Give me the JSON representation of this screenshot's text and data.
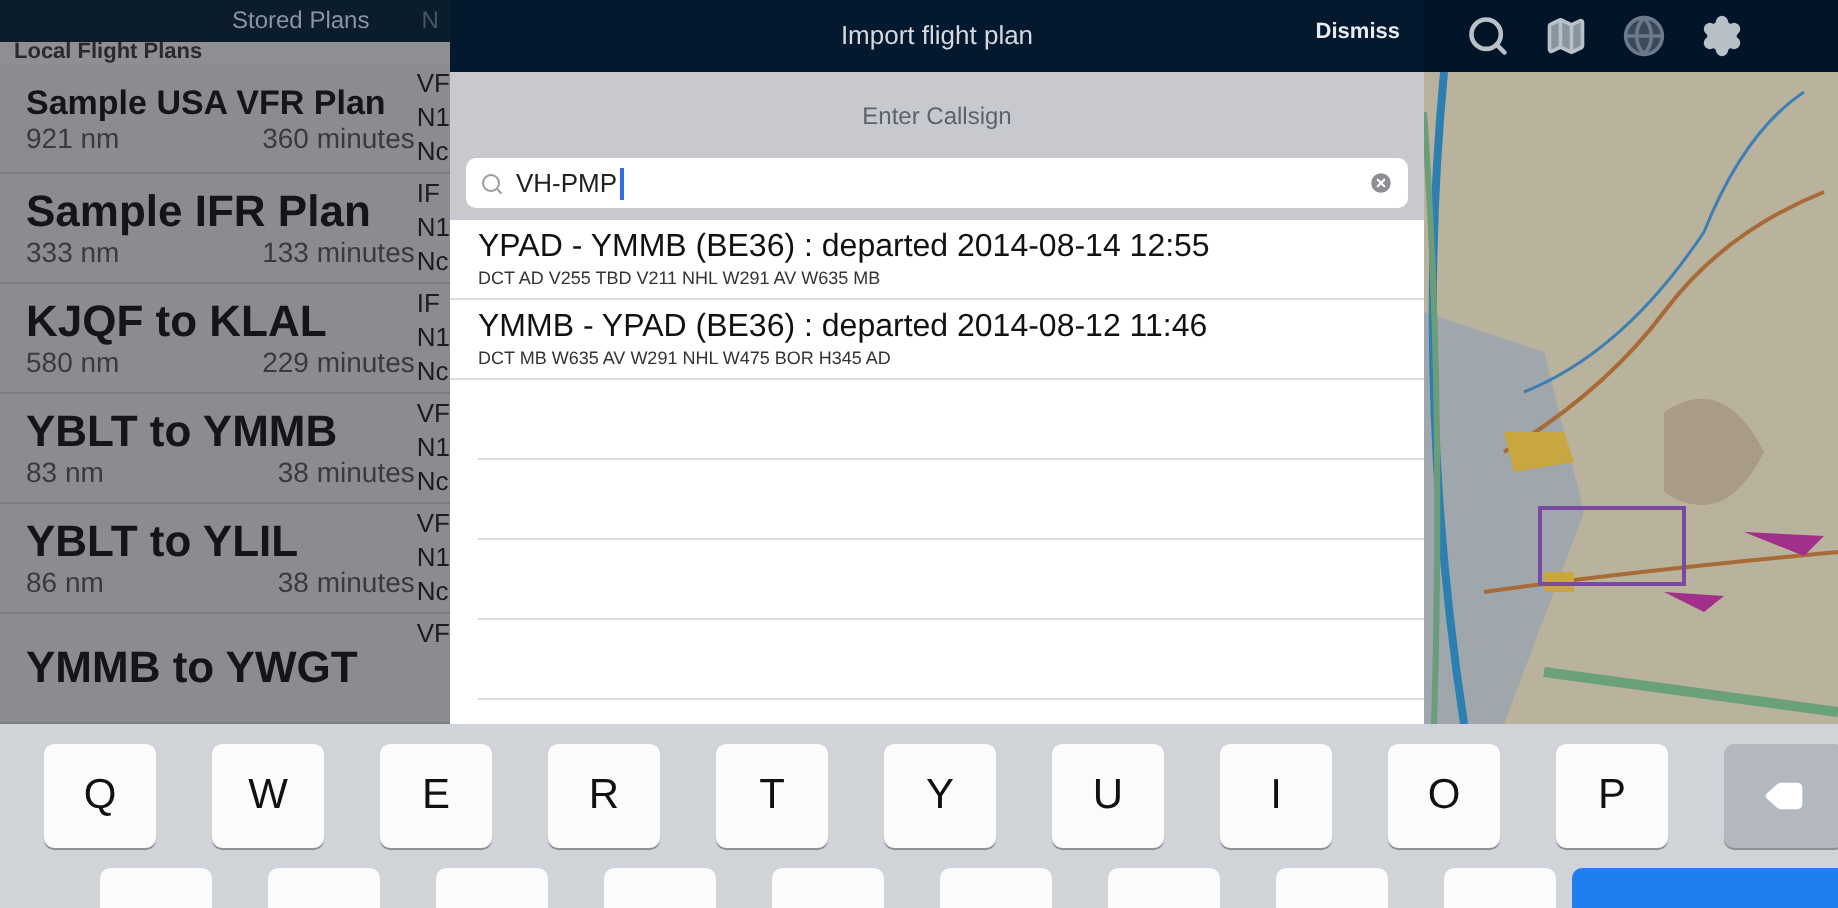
{
  "top_bar": {
    "left_title": "Stored Plans",
    "left_cut": "N"
  },
  "flight_plans": {
    "section": "Local Flight Plans",
    "items": [
      {
        "name": "Sample USA VFR Plan",
        "distance": "921 nm",
        "duration": "360 minutes",
        "column_3": [
          "VF",
          "N1",
          "Nc"
        ]
      },
      {
        "name": "Sample IFR Plan",
        "distance": "333 nm",
        "duration": "133 minutes",
        "column_3": [
          "IF",
          "N1",
          "Nc"
        ]
      },
      {
        "name": "KJQF to KLAL",
        "distance": "580 nm",
        "duration": "229 minutes",
        "column_3": [
          "IF",
          "N1",
          "Nc"
        ]
      },
      {
        "name": "YBLT to YMMB",
        "distance": "83 nm",
        "duration": "38 minutes",
        "column_3": [
          "VF",
          "N1",
          "Nc"
        ]
      },
      {
        "name": "YBLT to YLIL",
        "distance": "86 nm",
        "duration": "38 minutes",
        "column_3": [
          "VF",
          "N1",
          "Nc"
        ]
      },
      {
        "name": "YMMB to YWGT",
        "column_3": [
          "VF"
        ]
      }
    ]
  },
  "dialog": {
    "title": "Import flight plan",
    "dismiss": "Dismiss",
    "prompt": "Enter Callsign",
    "search": {
      "value": "VH-PMP"
    },
    "results": [
      {
        "title": "YPAD - YMMB (BE36) : departed 2014-08-14 12:55",
        "route": "DCT AD V255 TBD V211 NHL W291 AV W635 MB"
      },
      {
        "title": "YMMB - YPAD (BE36) : departed 2014-08-12 11:46",
        "route": "DCT MB W635 AV W291 NHL W475 BOR H345 AD"
      }
    ]
  },
  "keyboard": {
    "keys": [
      "Q",
      "W",
      "E",
      "R",
      "T",
      "Y",
      "U",
      "I",
      "O",
      "P"
    ]
  }
}
